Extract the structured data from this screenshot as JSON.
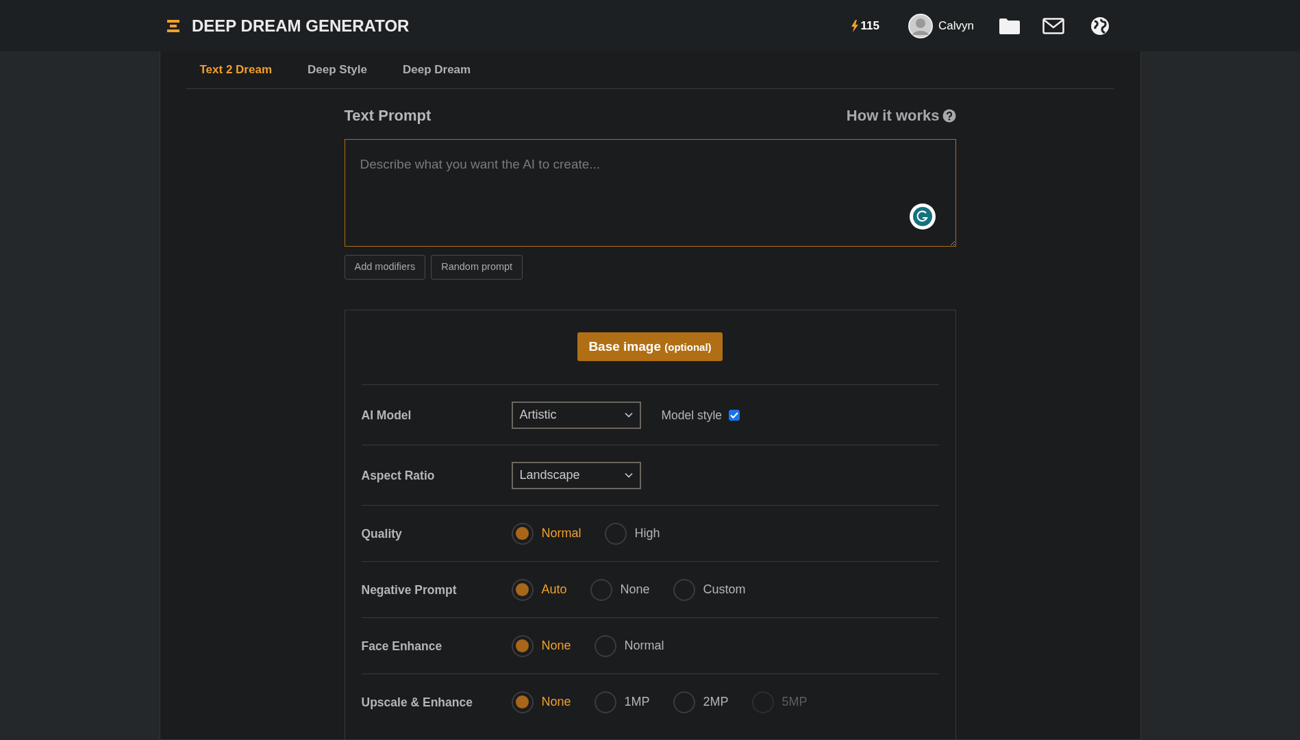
{
  "header": {
    "title": "DEEP DREAM GENERATOR",
    "energy": "115",
    "user": "Calvyn"
  },
  "tabs": [
    {
      "label": "Text 2 Dream",
      "selected": true
    },
    {
      "label": "Deep Style",
      "selected": false
    },
    {
      "label": "Deep Dream",
      "selected": false
    }
  ],
  "prompt": {
    "heading": "Text Prompt",
    "help_link": "How it works",
    "placeholder": "Describe what you want the AI to create...",
    "buttons": [
      "Add modifiers",
      "Random prompt"
    ]
  },
  "base_image_button": "Base image **(optional)**",
  "settings": [
    {
      "kind": "select",
      "label": "AI Model",
      "value": "Artistic",
      "checkbox": {
        "label": "Model style",
        "checked": true
      }
    },
    {
      "kind": "select",
      "label": "Aspect Ratio",
      "value": "Landscape"
    },
    {
      "kind": "radio",
      "label": "Quality",
      "options": [
        {
          "label": "Normal",
          "selected": true,
          "disabled": false
        },
        {
          "label": "High",
          "selected": false,
          "disabled": false
        }
      ]
    },
    {
      "kind": "radio",
      "label": "Negative Prompt",
      "options": [
        {
          "label": "Auto",
          "selected": true,
          "disabled": false
        },
        {
          "label": "None",
          "selected": false,
          "disabled": false
        },
        {
          "label": "Custom",
          "selected": false,
          "disabled": false
        }
      ]
    },
    {
      "kind": "radio",
      "label": "Face Enhance",
      "options": [
        {
          "label": "None",
          "selected": true,
          "disabled": false
        },
        {
          "label": "Normal",
          "selected": false,
          "disabled": false
        }
      ]
    },
    {
      "kind": "radio",
      "label": "Upscale & Enhance",
      "options": [
        {
          "label": "None",
          "selected": true,
          "disabled": false
        },
        {
          "label": "1MP",
          "selected": false,
          "disabled": false
        },
        {
          "label": "2MP",
          "selected": false,
          "disabled": false
        },
        {
          "label": "5MP",
          "selected": false,
          "disabled": true
        }
      ]
    }
  ]
}
